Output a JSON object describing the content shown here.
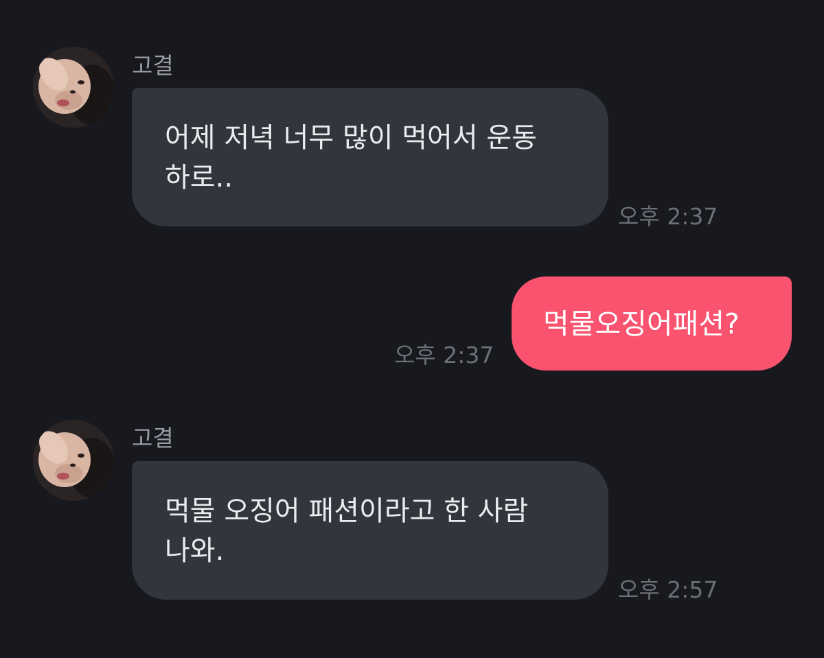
{
  "messages": [
    {
      "direction": "incoming",
      "sender": "고결",
      "text": "어제 저녁 너무 많이 먹어서 운동\n하로..",
      "time": "오후 2:37"
    },
    {
      "direction": "outgoing",
      "text": "먹물오징어패션?",
      "time": "오후 2:37"
    },
    {
      "direction": "incoming",
      "sender": "고결",
      "text": "먹물 오징어 패션이라고 한 사람\n나와.",
      "time": "오후 2:57"
    }
  ],
  "colors": {
    "background": "#18191e",
    "incoming_bubble": "#33353c",
    "outgoing_bubble": "#fa5370",
    "timestamp": "#6d6f76",
    "sender_name": "#9a9ca3"
  },
  "icons": {
    "avatar": "profile-photo"
  }
}
